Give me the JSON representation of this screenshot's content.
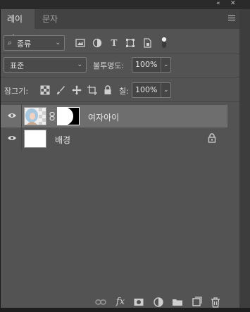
{
  "window": {
    "collapse_glyph": "«",
    "close_glyph": "✕"
  },
  "tabs": [
    {
      "label": "레이어",
      "active": true
    },
    {
      "label": "문자",
      "active": false
    }
  ],
  "filter": {
    "kind_label": "종류",
    "search_glyph": "⌕",
    "icons": [
      "image-filter-icon",
      "adjustment-filter-icon",
      "type-filter-icon",
      "shape-filter-icon",
      "smart-object-filter-icon",
      "filter-toggle-icon"
    ]
  },
  "blend": {
    "mode": "표준",
    "opacity_label": "불투명도:",
    "opacity_value": "100%"
  },
  "lock": {
    "label": "잠그기:",
    "fill_label": "칠:",
    "fill_value": "100%"
  },
  "layers": [
    {
      "name": "여자아이",
      "selected": true,
      "visible": true,
      "has_mask": true,
      "locked": false
    },
    {
      "name": "배경",
      "selected": false,
      "visible": true,
      "has_mask": false,
      "locked": true
    }
  ],
  "footer_icons": [
    "link-layers-icon",
    "fx-icon",
    "add-mask-icon",
    "adjustment-layer-icon",
    "new-group-icon",
    "new-layer-icon",
    "delete-layer-icon"
  ],
  "colors": {
    "panel": "#535353",
    "selected_row": "#6e6e6e",
    "tab_bar": "#424242"
  }
}
